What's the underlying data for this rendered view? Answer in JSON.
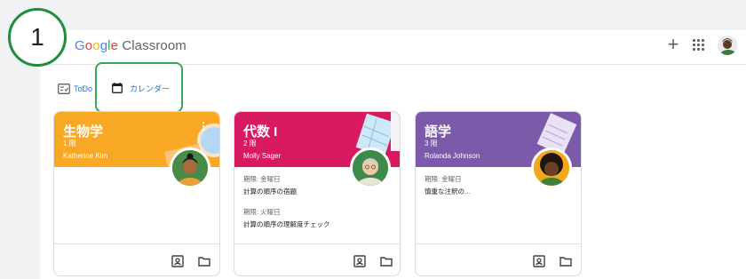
{
  "step_number": "1",
  "app": {
    "logo_letters": [
      "G",
      "o",
      "o",
      "g",
      "l",
      "e"
    ],
    "logo_product": "Classroom"
  },
  "tabs": {
    "todo": "ToDo",
    "calendar": "カレンダー"
  },
  "colors": {
    "accent": "#1a73e8",
    "step_ring": "#1e8e3e",
    "biology": "#f9a825",
    "algebra": "#d81b60",
    "language": "#7b5ba9"
  },
  "cards": [
    {
      "title": "生物学",
      "period": "1 限",
      "teacher": "Katherine Kim",
      "assignments": []
    },
    {
      "title": "代数 I",
      "period": "2 限",
      "teacher": "Molly Sager",
      "assignments": [
        {
          "due": "期限: 金曜日",
          "title": "計算の順序の宿題"
        },
        {
          "due": "期限: 火曜日",
          "title": "計算の順序の理解度チェック"
        }
      ]
    },
    {
      "title": "語学",
      "period": "3 限",
      "teacher": "Rolanda Johnson",
      "assignments": [
        {
          "due": "期限: 金曜日",
          "title": "慎重な注釈の..."
        }
      ]
    }
  ],
  "icons": {
    "add": "plus-icon",
    "apps": "apps-grid-icon",
    "todo": "todo-list-icon",
    "calendar": "calendar-icon",
    "work": "portrait-icon",
    "folder": "folder-icon",
    "more": "more-vert-icon"
  }
}
